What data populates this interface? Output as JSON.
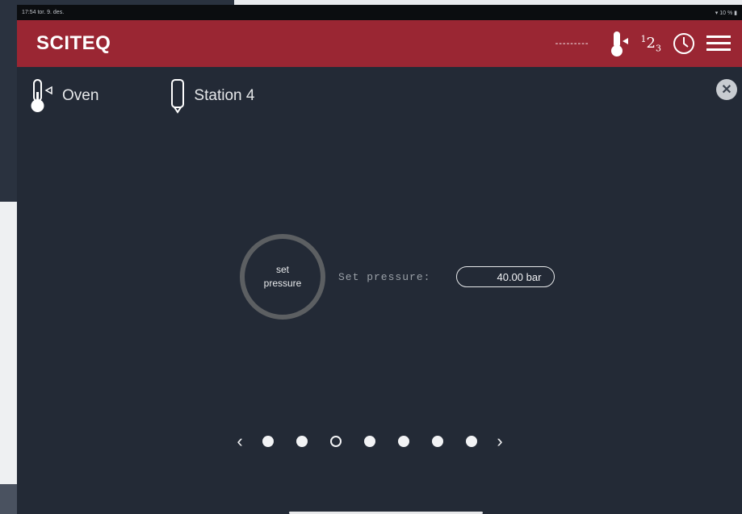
{
  "statusbar": {
    "left": "17:54  tor. 9. des.",
    "right": "▾ 10 % ▮"
  },
  "appbar": {
    "brand": "SCITEQ",
    "dashes": "---------"
  },
  "header": {
    "oven_label": "Oven",
    "station_label": "Station 4"
  },
  "setpoint": {
    "ring_line1": "set",
    "ring_line2": "pressure",
    "label": "Set pressure:",
    "value": "40.00  bar"
  },
  "pager": {
    "prev": "‹",
    "next": "›",
    "dots": 7,
    "active_index": 2
  },
  "colors": {
    "accent": "#9a2633",
    "background": "#232a36"
  },
  "icons": [
    "thermometer-icon",
    "counter-icon",
    "clock-icon",
    "menu-icon",
    "oven-icon",
    "station-tube-icon",
    "close-icon"
  ]
}
